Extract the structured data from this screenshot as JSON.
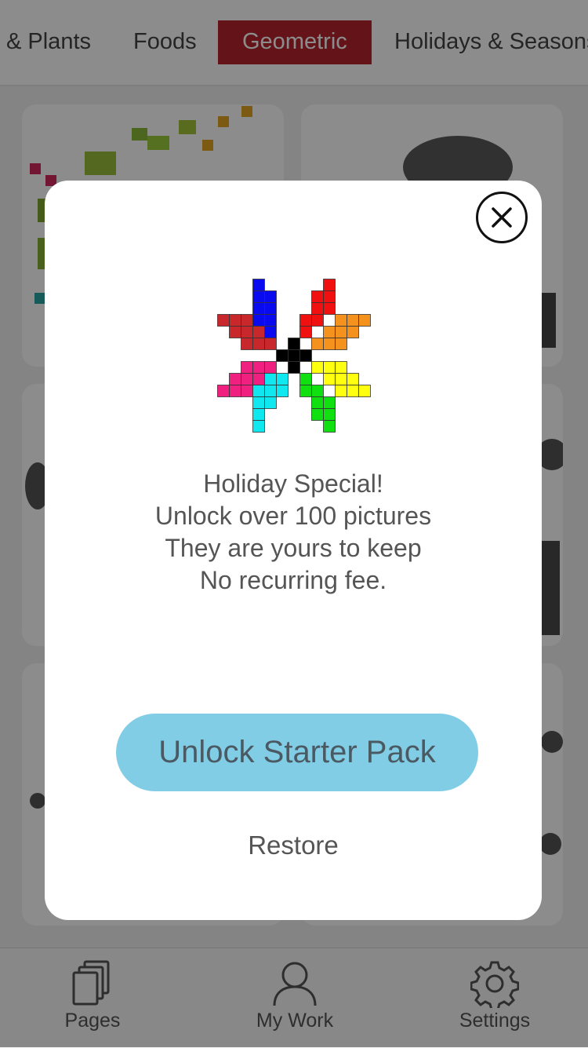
{
  "categories": {
    "items": [
      "& Plants",
      "Foods",
      "Geometric",
      "Holidays & Seasons"
    ],
    "active": "Geometric"
  },
  "modal": {
    "message_lines": [
      "Holiday Special!",
      "Unlock over 100 pictures",
      "They are yours to keep",
      "No recurring fee."
    ],
    "unlock_label": "Unlock Starter Pack",
    "restore_label": "Restore",
    "close_icon": "close-icon",
    "logo_icon": "pixel-star-logo"
  },
  "bottom_nav": {
    "items": [
      {
        "label": "Pages",
        "icon": "pages-icon"
      },
      {
        "label": "My Work",
        "icon": "user-icon"
      },
      {
        "label": "Settings",
        "icon": "gear-icon"
      }
    ]
  },
  "colors": {
    "accent": "#b6252f",
    "unlock_button": "#82cde6",
    "overlay": "rgba(0,0,0,0.45)"
  }
}
